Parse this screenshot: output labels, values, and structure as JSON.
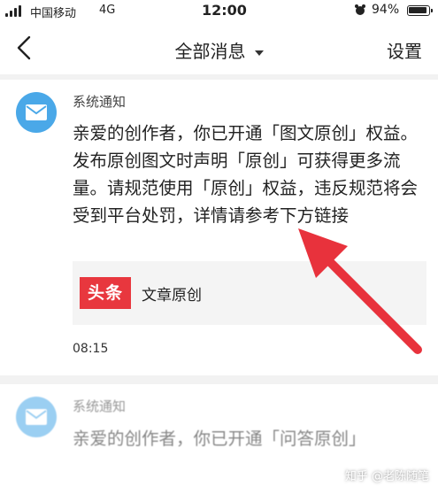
{
  "status_bar": {
    "carrier": "中国移动",
    "network": "4G",
    "time": "12:00",
    "battery_percent": "94%",
    "battery_level": 0.94
  },
  "nav": {
    "title": "全部消息",
    "settings_label": "设置"
  },
  "messages": [
    {
      "sender": "系统通知",
      "body": "亲爱的创作者，你已开通「图文原创」权益。发布原创图文时声明「原创」可获得更多流量。请规范使用「原创」权益，违反规范将会受到平台处罚，详情请参考下方链接",
      "link_logo": "头条",
      "link_label": "文章原创",
      "time": "08:15"
    },
    {
      "sender": "系统通知",
      "body": "亲爱的创作者，你已开通「问答原创」"
    }
  ],
  "watermark": "知乎 @老陈随笔",
  "colors": {
    "accent_blue": "#4aa8e8",
    "toutiao_red": "#e8373e",
    "arrow_red": "#e8323c"
  }
}
